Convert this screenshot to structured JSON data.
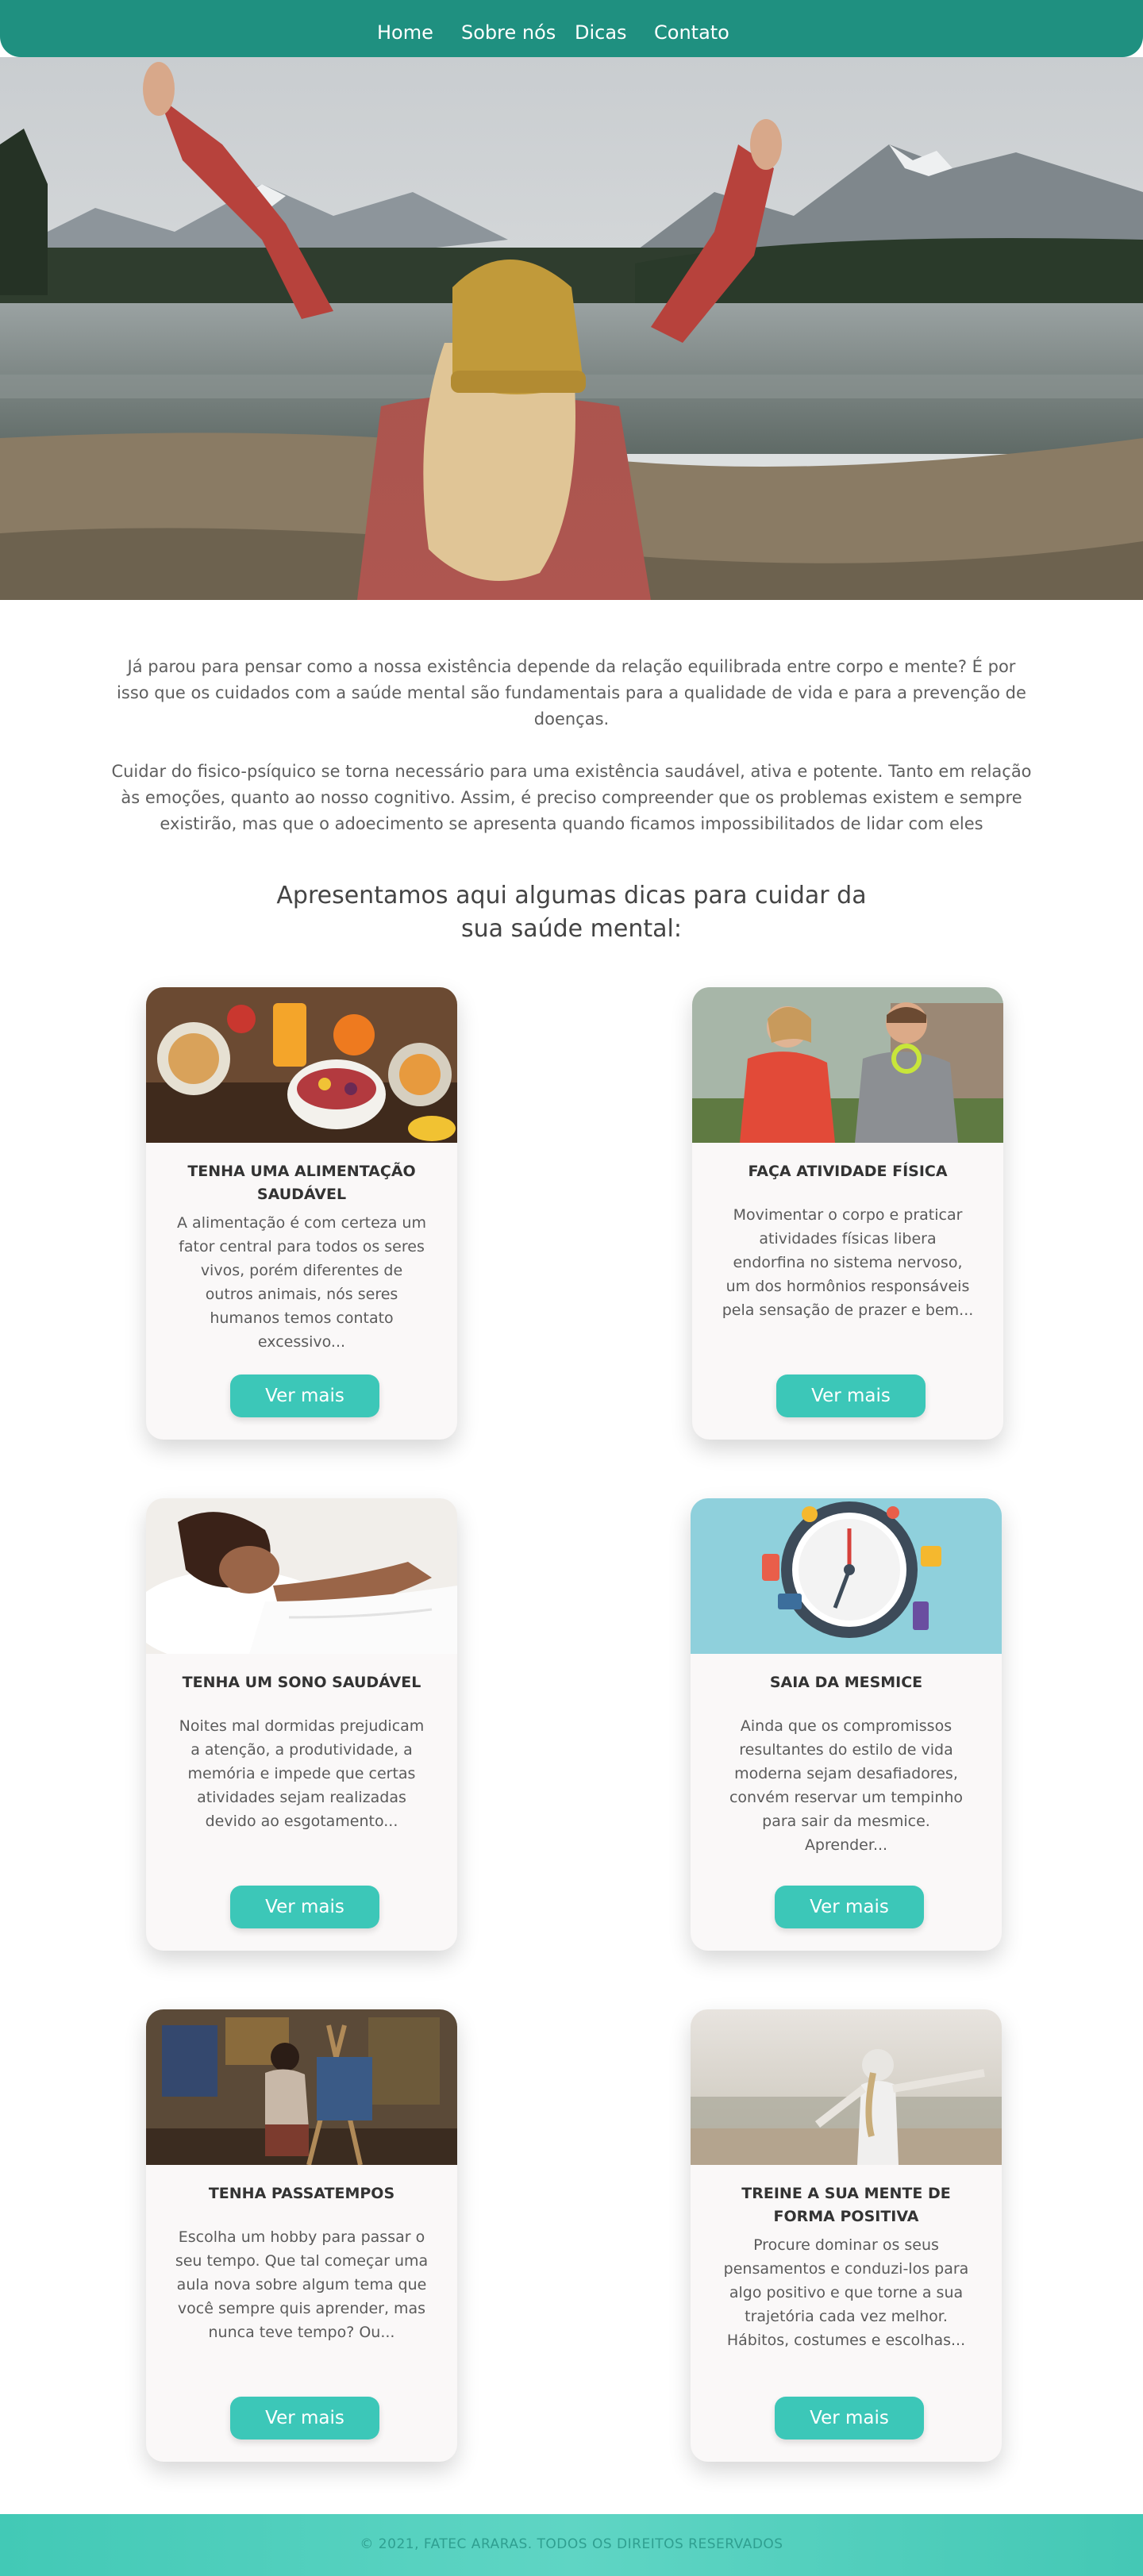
{
  "nav": {
    "home": "Home",
    "about": "Sobre nós",
    "tips": "Dicas",
    "contact": "Contato"
  },
  "intro": {
    "paragraph1": "Já parou para pensar como a nossa existência depende da relação equilibrada entre corpo e mente? É por isso que os cuidados com a saúde mental são fundamentais para a qualidade de vida e para a prevenção de doenças.",
    "paragraph2": "Cuidar do fisico-psíquico se torna necessário para uma existência saudável, ativa e potente. Tanto em relação às emoções, quanto ao nosso cognitivo. Assim, é preciso compreender que os problemas existem e sempre existirão, mas que o adoecimento se apresenta quando ficamos impossibilitados de lidar com eles",
    "subtitle": "Apresentamos aqui algumas dicas para cuidar da sua saúde mental:"
  },
  "cards": [
    {
      "title": "TENHA UMA ALIMENTAÇÃO SAUDÁVEL",
      "text": "A alimentação é com certeza um fator central para todos os seres vivos, porém diferentes de outros animais, nós seres humanos temos contato excessivo...",
      "button": "Ver mais"
    },
    {
      "title": "FAÇA ATIVIDADE FÍSICA",
      "text": "Movimentar o corpo e praticar atividades físicas libera endorfina no sistema nervoso, um dos hormônios responsáveis pela sensação de prazer e bem...",
      "button": "Ver mais"
    },
    {
      "title": "TENHA UM SONO SAUDÁVEL",
      "text": "Noites mal dormidas prejudicam a atenção, a produtividade, a memória e impede que certas atividades sejam realizadas devido ao esgotamento...",
      "button": "Ver mais"
    },
    {
      "title": "SAIA DA MESMICE",
      "text": "Ainda que os compromissos resultantes do estilo de vida moderna sejam desafiadores, convém reservar um tempinho para sair da mesmice. Aprender...",
      "button": "Ver mais"
    },
    {
      "title": "TENHA PASSATEMPOS",
      "text": "Escolha um hobby para passar o seu tempo. Que tal começar uma aula nova sobre algum tema que você sempre quis aprender, mas nunca teve tempo? Ou...",
      "button": "Ver mais"
    },
    {
      "title": "TREINE A SUA MENTE DE FORMA POSITIVA",
      "text": "Procure dominar os seus pensamentos e conduzi-los para algo positivo e que torne a sua trajetória cada vez melhor. Hábitos, costumes e escolhas...",
      "button": "Ver mais"
    }
  ],
  "footer": {
    "copyright": "© 2021, FATEC ARARAS. TODOS OS DIREITOS RESERVADOS"
  },
  "colors": {
    "nav_bg": "#1f9080",
    "button_bg": "#3cc7b8",
    "footer_bg": "#4ccdbb"
  }
}
